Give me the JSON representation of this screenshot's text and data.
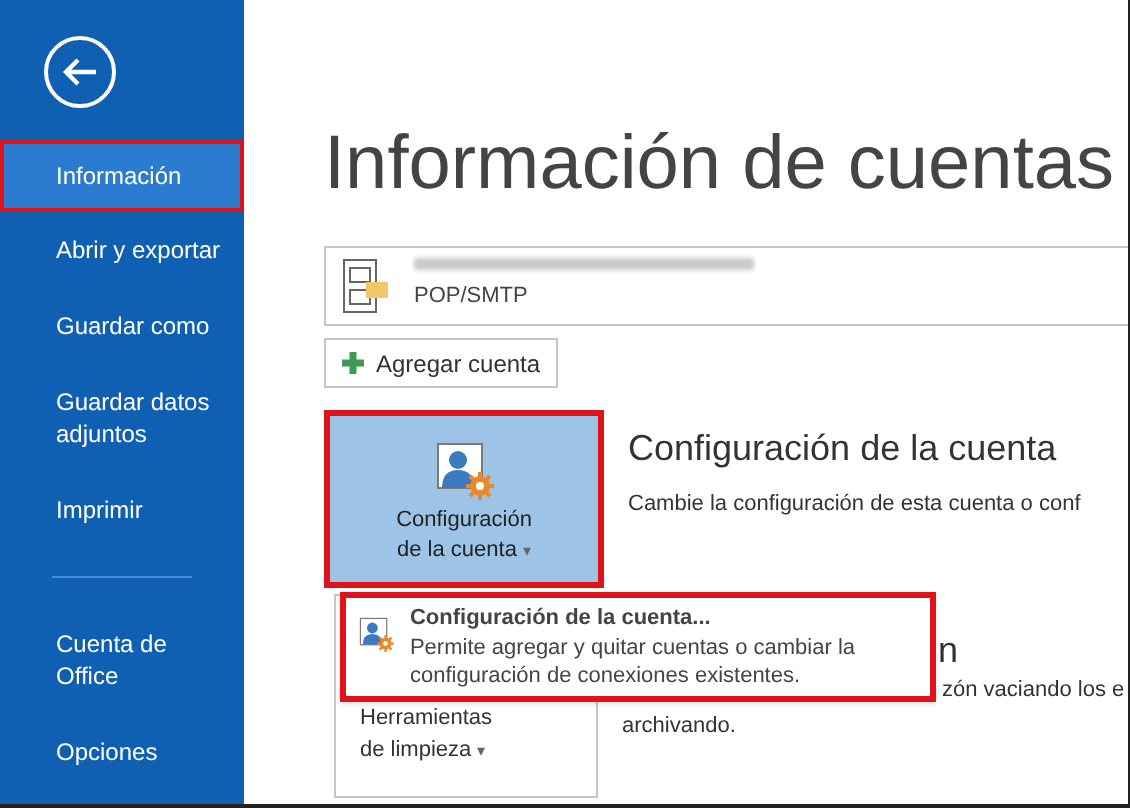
{
  "sidebar": {
    "items": [
      {
        "label": "Información",
        "selected": true,
        "highlighted": true
      },
      {
        "label": "Abrir y exportar",
        "selected": false,
        "highlighted": false
      },
      {
        "label": "Guardar como",
        "selected": false,
        "highlighted": false
      },
      {
        "label": "Guardar datos adjuntos",
        "selected": false,
        "highlighted": false
      },
      {
        "label": "Imprimir",
        "selected": false,
        "highlighted": false
      },
      {
        "kind": "divider"
      },
      {
        "label": "Cuenta de Office",
        "selected": false,
        "highlighted": false
      },
      {
        "label": "Opciones",
        "selected": false,
        "highlighted": false
      }
    ]
  },
  "title": "Información de cuentas",
  "account": {
    "type": "POP/SMTP"
  },
  "add_account_button": "Agregar cuenta",
  "account_settings": {
    "tile": {
      "label_lines": [
        "Configuración",
        "de la cuenta"
      ],
      "caret": "▾",
      "highlighted": true
    },
    "heading": "Configuración de la cuenta",
    "description": "Cambie la configuración de esta cuenta o conf"
  },
  "cleanup": {
    "tile": {
      "label_lines": [
        "Herramientas",
        "de limpieza"
      ],
      "caret": "▾"
    },
    "heading": "n",
    "description_lines": [
      "zón vaciando los e",
      "archivando."
    ]
  },
  "menu": {
    "items": [
      {
        "title": "Configuración de la cuenta...",
        "description": "Permite agregar y quitar cuentas o cambiar la configuración de conexiones existentes.",
        "highlighted": true
      }
    ]
  }
}
